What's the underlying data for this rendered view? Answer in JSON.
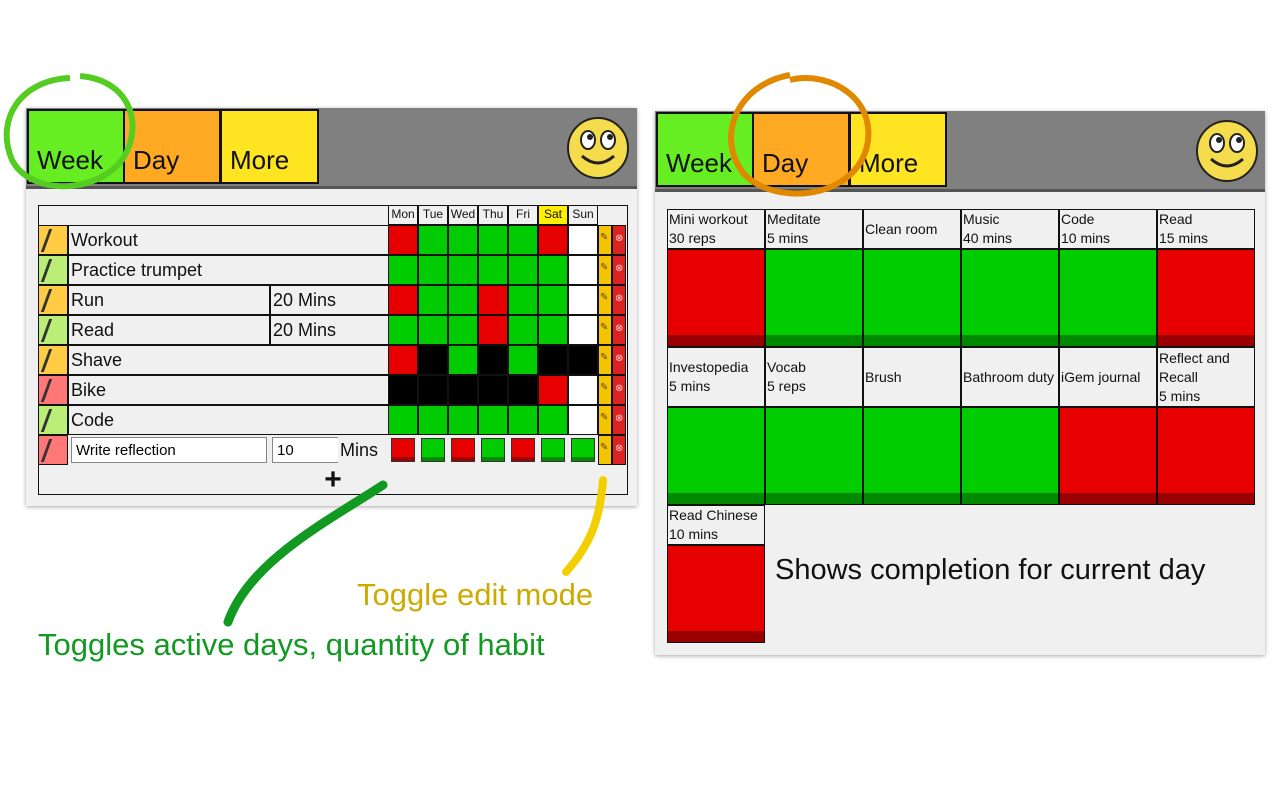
{
  "week_panel": {
    "tabs": {
      "week": "Week",
      "day": "Day",
      "more": "More"
    },
    "days": [
      "Mon",
      "Tue",
      "Wed",
      "Thu",
      "Fri",
      "Sat",
      "Sun"
    ],
    "habits": [
      {
        "name": "Workout",
        "quantity": "",
        "color": "#ffcc44",
        "days": [
          "r",
          "g",
          "g",
          "g",
          "g",
          "r",
          "w"
        ]
      },
      {
        "name": "Practice trumpet",
        "quantity": "",
        "color": "#bbee77",
        "days": [
          "g",
          "g",
          "g",
          "g",
          "g",
          "g",
          "w"
        ]
      },
      {
        "name": "Run",
        "quantity": "20 Mins",
        "color": "#ffcc44",
        "days": [
          "r",
          "g",
          "g",
          "r",
          "g",
          "g",
          "w"
        ]
      },
      {
        "name": "Read",
        "quantity": "20 Mins",
        "color": "#bbee77",
        "days": [
          "g",
          "g",
          "g",
          "r",
          "g",
          "g",
          "w"
        ]
      },
      {
        "name": "Shave",
        "quantity": "",
        "color": "#ffcc44",
        "days": [
          "r",
          "b",
          "g",
          "b",
          "g",
          "b",
          "b"
        ]
      },
      {
        "name": "Bike",
        "quantity": "",
        "color": "#ff7777",
        "days": [
          "b",
          "b",
          "b",
          "b",
          "b",
          "r",
          "w"
        ]
      },
      {
        "name": "Code",
        "quantity": "",
        "color": "#bbee77",
        "days": [
          "g",
          "g",
          "g",
          "g",
          "g",
          "g",
          "w"
        ]
      }
    ],
    "edit_row": {
      "name_value": "Write reflection",
      "quantity_value": "10",
      "unit": "Mins",
      "color": "#ff7777",
      "days": [
        "r",
        "g",
        "r",
        "g",
        "r",
        "g",
        "g"
      ]
    },
    "add_label": "+"
  },
  "day_panel": {
    "tabs": {
      "week": "Week",
      "day": "Day",
      "more": "More"
    },
    "items": [
      {
        "line1": "Mini workout",
        "line2": "30 reps",
        "line3": "",
        "status": "red"
      },
      {
        "line1": "Meditate",
        "line2": "5 mins",
        "line3": "",
        "status": "green"
      },
      {
        "line1": "Clean room",
        "line2": "",
        "line3": "",
        "status": "green"
      },
      {
        "line1": "Music",
        "line2": "40 mins",
        "line3": "",
        "status": "green"
      },
      {
        "line1": "Code",
        "line2": "10 mins",
        "line3": "",
        "status": "green"
      },
      {
        "line1": "Read",
        "line2": "15 mins",
        "line3": "",
        "status": "red"
      },
      {
        "line1": "Investopedia",
        "line2": "5 mins",
        "line3": "",
        "status": "green"
      },
      {
        "line1": "Vocab",
        "line2": "5 reps",
        "line3": "",
        "status": "green"
      },
      {
        "line1": "Brush",
        "line2": "",
        "line3": "",
        "status": "green"
      },
      {
        "line1": "Bathroom duty",
        "line2": "",
        "line3": "",
        "status": "green"
      },
      {
        "line1": "iGem journal",
        "line2": "",
        "line3": "",
        "status": "red"
      },
      {
        "line1": "Reflect and",
        "line2": "Recall",
        "line3": "5 mins",
        "status": "red"
      },
      {
        "line1": "Read Chinese",
        "line2": "10 mins",
        "line3": "",
        "status": "red"
      }
    ],
    "caption": "Shows completion for current day"
  },
  "annotations": {
    "toggle_days": "Toggles active days, quantity of habit",
    "toggle_edit": "Toggle edit mode",
    "colors": {
      "green_note": "#119922",
      "yellow_note": "#ccaa00",
      "week_circle": "#55cc22",
      "day_circle": "#e08800",
      "green_stroke": "#119922",
      "yellow_stroke": "#f2d000"
    }
  }
}
